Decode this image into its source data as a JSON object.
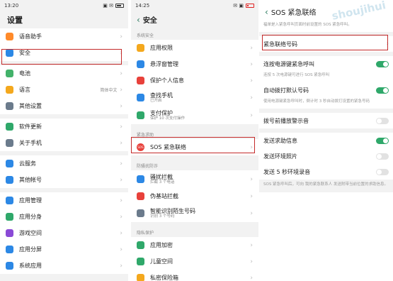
{
  "colors": {
    "accent": "#2fa86a",
    "highlight": "#c42a2a"
  },
  "panel1": {
    "status": {
      "time": "13:20",
      "icons": "▣ ✉"
    },
    "title": "设置",
    "rows": [
      {
        "label": "语音助手",
        "icon": "mic-icon",
        "color": "#ff8a2a"
      },
      {
        "label": "安全",
        "icon": "shield-icon",
        "color": "#2c88e5"
      },
      {
        "label": "电池",
        "icon": "battery-icon",
        "color": "#43b26a"
      },
      {
        "label": "语言",
        "icon": "language-icon",
        "color": "#f4a81d",
        "value": "简体中文"
      },
      {
        "label": "其他设置",
        "icon": "gear-icon",
        "color": "#6b7b8c"
      },
      {
        "label": "软件更新",
        "icon": "update-icon",
        "color": "#2fa86a"
      },
      {
        "label": "关于手机",
        "icon": "info-icon",
        "color": "#6b7b8c"
      },
      {
        "label": "云服务",
        "icon": "cloud-icon",
        "color": "#2c88e5"
      },
      {
        "label": "其他帐号",
        "icon": "account-icon",
        "color": "#2c88e5"
      },
      {
        "label": "应用管理",
        "icon": "apps-icon",
        "color": "#2c88e5"
      },
      {
        "label": "应用分身",
        "icon": "clone-icon",
        "color": "#2fa86a"
      },
      {
        "label": "游戏空间",
        "icon": "game-icon",
        "color": "#8a4ad6"
      },
      {
        "label": "应用分屏",
        "icon": "split-icon",
        "color": "#2c88e5"
      },
      {
        "label": "系统应用",
        "icon": "system-apps-icon",
        "color": "#2c88e5"
      }
    ]
  },
  "panel2": {
    "status": {
      "time": "14:25",
      "icons": "✉ ▣"
    },
    "title": "安全",
    "sections": {
      "s1": "系统安全",
      "s2": "紧急求助",
      "s3": "防骚扰防诈",
      "s4": "隐私保护"
    },
    "rows": [
      {
        "label": "应用权限",
        "icon": "permission-icon",
        "color": "#f4a81d"
      },
      {
        "label": "悬浮窗管理",
        "icon": "float-window-icon",
        "color": "#2c88e5"
      },
      {
        "label": "保护个人信息",
        "icon": "privacy-icon",
        "color": "#e8413b"
      },
      {
        "label": "查找手机",
        "sub": "已开启",
        "icon": "find-phone-icon",
        "color": "#2c88e5"
      },
      {
        "label": "支付保护",
        "sub": "保护 10 次支付操作",
        "icon": "payment-icon",
        "color": "#2fa86a"
      },
      {
        "label": "SOS 紧急联络",
        "icon": "sos-icon",
        "color": "#e8413b",
        "badge": "SOS"
      },
      {
        "label": "骚扰拦截",
        "sub": "拦截 3 个电话",
        "icon": "block-icon",
        "color": "#2c88e5"
      },
      {
        "label": "伪基站拦截",
        "icon": "fake-station-icon",
        "color": "#e8413b"
      },
      {
        "label": "智能识别陌生号码",
        "sub": "识别 3 个号码",
        "icon": "caller-id-icon",
        "color": "#6b7b8c"
      },
      {
        "label": "应用加密",
        "icon": "app-lock-icon",
        "color": "#2fa86a"
      },
      {
        "label": "儿童空间",
        "icon": "kids-icon",
        "color": "#2fa86a"
      },
      {
        "label": "私密保险箱",
        "icon": "safe-icon",
        "color": "#f4a81d"
      }
    ]
  },
  "panel3": {
    "title": "SOS 紧急联络",
    "intro": "福单是入紧急呼叫页面时前设置的 SOS 紧急呼叫。",
    "contact_label": "紧急联络号码",
    "rows": [
      {
        "label": "连按电源键紧急呼叫",
        "toggle": "on",
        "desc": "连按 5 次电源键可进行 SOS 紧急呼叫"
      },
      {
        "label": "自动拨打默认号码",
        "toggle": "on",
        "desc": "使用电源键紧急呼叫时，倒计时 3 秒自动拨打设置的紧急号码"
      },
      {
        "label": "拨号前播放警示音",
        "toggle": "off"
      },
      {
        "label": "发送求助信息",
        "toggle": "on"
      },
      {
        "label": "发送环境照片",
        "toggle": "off"
      },
      {
        "label": "发送 5 秒环境录音",
        "toggle": "off"
      }
    ],
    "footer": "SOS 紧急呼叫后，可向 我的紧急联系人 发送附带当前位置的求助信息。",
    "watermark": "shoujihui"
  }
}
